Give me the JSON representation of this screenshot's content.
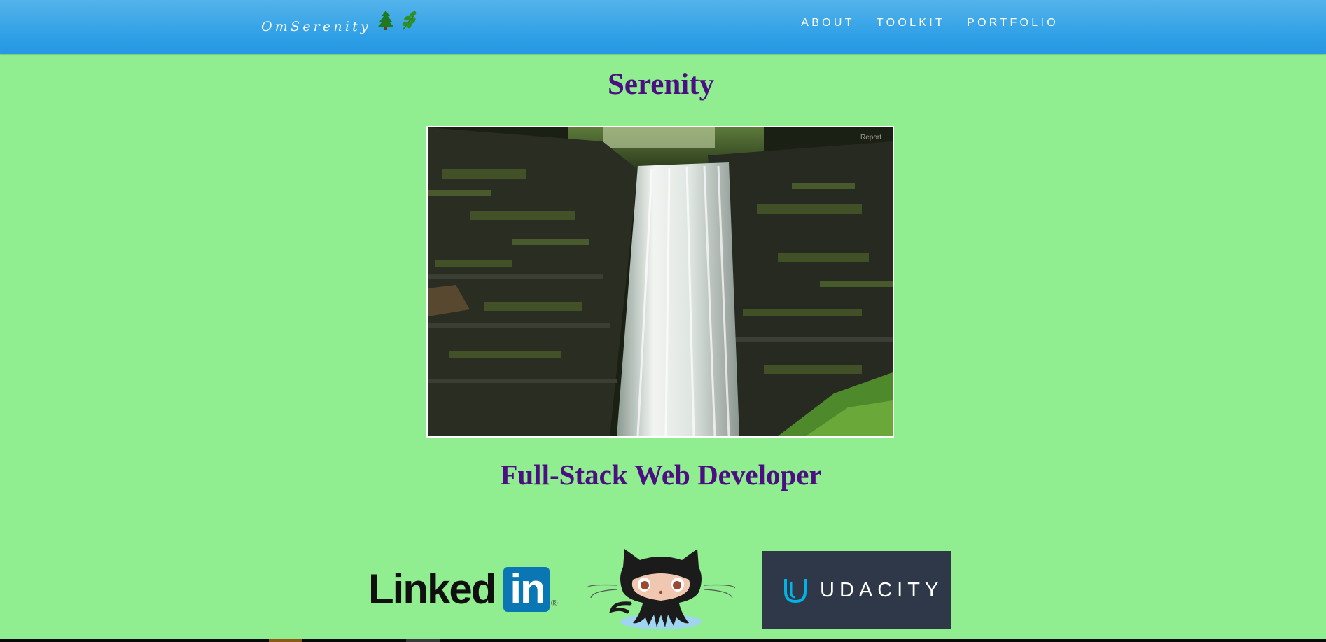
{
  "nav": {
    "brand": "OmSerenity",
    "brand_icons": [
      "tree-icon",
      "leaf-icon"
    ],
    "links": [
      "ABOUT",
      "TOOLKIT",
      "PORTFOLIO"
    ]
  },
  "hero": {
    "title": "Serenity",
    "image_overlay": "Report",
    "subtitle": "Full-Stack Web Developer"
  },
  "social": {
    "linkedin": {
      "word": "Linked",
      "badge": "in",
      "mark": "®"
    },
    "github": {
      "logo": "github-octocat-logo"
    },
    "udacity": {
      "word": "UDACITY"
    }
  },
  "colors": {
    "background": "#90ee90",
    "navbar": "#2d9fe6",
    "heading": "#4b0f82",
    "linkedin_blue": "#0a76b4",
    "udacity_bg": "#2e3848",
    "udacity_accent": "#02b3e4"
  }
}
